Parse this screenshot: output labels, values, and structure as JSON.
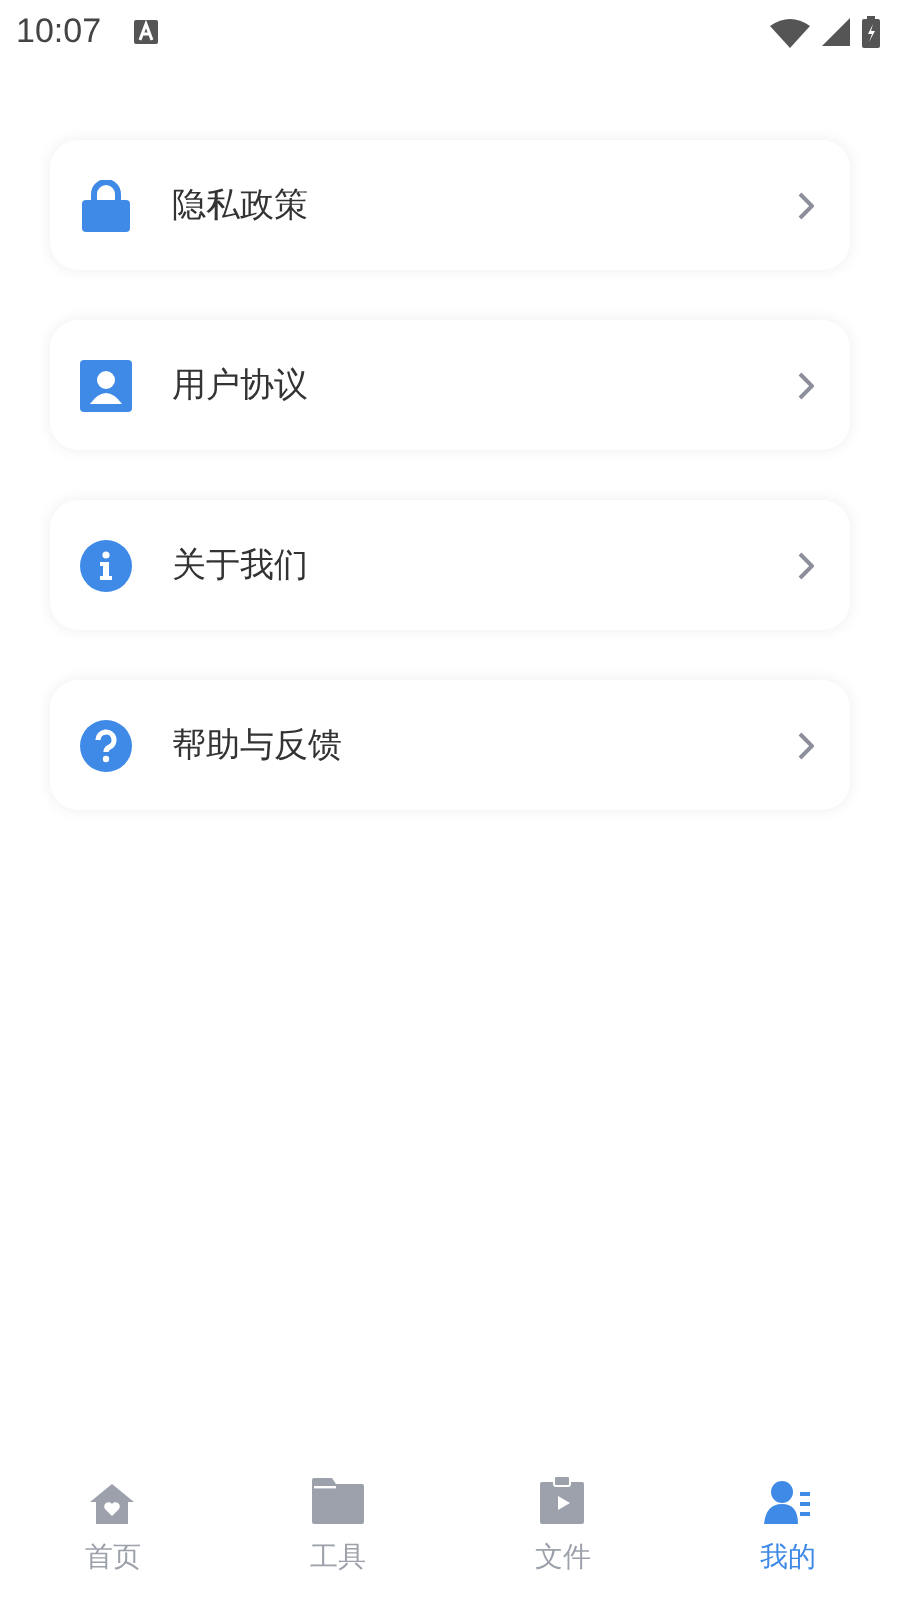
{
  "status_bar": {
    "time": "10:07"
  },
  "menu": [
    {
      "kind": "lock",
      "label": "隐私政策"
    },
    {
      "kind": "contact",
      "label": "用户协议"
    },
    {
      "kind": "info",
      "label": "关于我们"
    },
    {
      "kind": "help",
      "label": "帮助与反馈"
    }
  ],
  "tabs": [
    {
      "kind": "home",
      "label": "首页",
      "selected": false
    },
    {
      "kind": "folder",
      "label": "工具",
      "selected": false
    },
    {
      "kind": "clipboard",
      "label": "文件",
      "selected": false
    },
    {
      "kind": "profile",
      "label": "我的",
      "selected": true
    }
  ]
}
